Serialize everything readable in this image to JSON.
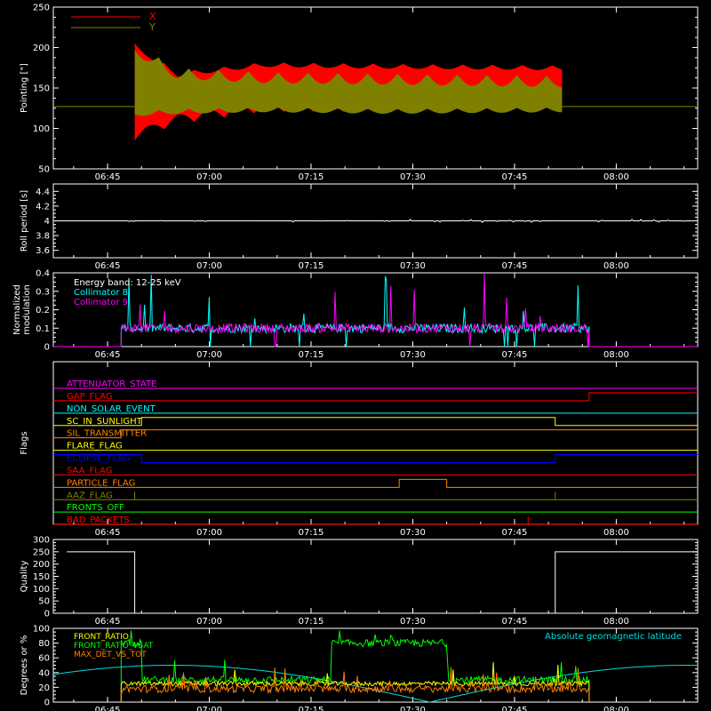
{
  "time_ticks": [
    "06:45",
    "07:00",
    "07:15",
    "07:30",
    "07:45",
    "08:00"
  ],
  "colors": {
    "background": "#000000",
    "axis": "#ffffff",
    "x_series": "#ff0000",
    "y_series": "#808000",
    "collimator8": "#00ffff",
    "collimator9": "#ff00ff",
    "geomag": "#00dddd",
    "front_ratio": "#ffff00",
    "front_ratio_vsat": "#00ff00",
    "max_det_vs_tot": "#ff8000"
  },
  "chart_data": [
    {
      "type": "line",
      "name": "pointing",
      "ylabel": "Pointing [\"]",
      "ylim": [
        50,
        250
      ],
      "yticks": [
        50,
        100,
        150,
        200,
        250
      ],
      "legend": {
        "placement": "top-left",
        "entries": [
          "X",
          "Y"
        ]
      },
      "series": [
        {
          "name": "X",
          "color": "#ff0000",
          "baseline": 127,
          "active_start": "06:49",
          "active_end": "07:52",
          "envelope_upper": [
            [
              0,
              205
            ],
            [
              0.1,
              170
            ],
            [
              0.3,
              182
            ],
            [
              0.6,
              180
            ],
            [
              1,
              178
            ]
          ],
          "envelope_lower": [
            [
              0,
              85
            ],
            [
              0.1,
              105
            ],
            [
              0.3,
              120
            ],
            [
              0.6,
              120
            ],
            [
              1,
              122
            ]
          ]
        },
        {
          "name": "Y",
          "color": "#808000",
          "baseline": 127,
          "active_start": "06:49",
          "active_end": "07:52",
          "envelope_upper": [
            [
              0,
              205
            ],
            [
              0.1,
              175
            ],
            [
              0.3,
              170
            ],
            [
              0.6,
              168
            ],
            [
              1,
              165
            ]
          ],
          "envelope_lower": [
            [
              0,
              115
            ],
            [
              0.1,
              118
            ],
            [
              0.3,
              120
            ],
            [
              0.6,
              118
            ],
            [
              1,
              120
            ]
          ]
        }
      ]
    },
    {
      "type": "line",
      "name": "roll-period",
      "ylabel": "Roll period [s]",
      "ylim": [
        3.5,
        4.5
      ],
      "yticks": [
        3.6,
        3.8,
        4.0,
        4.2,
        4.4
      ],
      "series": [
        {
          "name": "",
          "color": "#ffffff",
          "value": 4.0
        }
      ]
    },
    {
      "type": "line",
      "name": "modulation",
      "ylabel": [
        "Normalized",
        "modulation"
      ],
      "ylim": [
        0,
        0.4
      ],
      "yticks": [
        0.0,
        0.1,
        0.2,
        0.3,
        0.4
      ],
      "legend": {
        "placement": "top-left",
        "entries": [
          "Energy band: 12-25 keV",
          "Collimator 8",
          "Collimator 9"
        ]
      },
      "active_start": "06:47",
      "active_end": "07:56",
      "series": [
        {
          "name": "Collimator 8",
          "color": "#00ffff",
          "typical": 0.1
        },
        {
          "name": "Collimator 9",
          "color": "#ff00ff",
          "typical": 0.1
        }
      ]
    },
    {
      "type": "line",
      "name": "flags",
      "ylabel": "Flags",
      "flags": [
        {
          "label": "ATTENUATOR_STATE",
          "color": "#ff00ff",
          "steps": []
        },
        {
          "label": "GAP_FLAG",
          "color": "#ff0000",
          "steps": [
            [
              "07:56",
              1
            ]
          ]
        },
        {
          "label": "NON_SOLAR_EVENT",
          "color": "#00ffff",
          "steps": []
        },
        {
          "label": "SC_IN_SUNLIGHT",
          "color": "#ffff00",
          "steps": [
            [
              "06:50",
              1
            ],
            [
              "07:51",
              0
            ]
          ]
        },
        {
          "label": "SIL_TRANSMITTER",
          "color": "#ff8000",
          "steps": [
            [
              "06:47",
              1
            ]
          ]
        },
        {
          "label": "FLARE_FLAG",
          "color": "#ffff00",
          "steps": []
        },
        {
          "label": "ECLIPSE_FLAG",
          "color": "#0000ff",
          "steps": [
            [
              "06:50",
              0
            ],
            [
              "07:51",
              1
            ]
          ]
        },
        {
          "label": "SAA_FLAG",
          "color": "#ff0000",
          "steps": []
        },
        {
          "label": "PARTICLE_FLAG",
          "color": "#ff8000",
          "steps": [
            [
              "07:28",
              1
            ],
            [
              "07:35",
              0
            ]
          ]
        },
        {
          "label": "AAZ_FLAG",
          "color": "#808000",
          "spikes": [
            "06:49",
            "07:51"
          ]
        },
        {
          "label": "FRONTS_OFF",
          "color": "#00ff00",
          "steps": []
        },
        {
          "label": "BAD_PACKETS",
          "color": "#ff0000",
          "spikes": [
            "07:47"
          ]
        }
      ]
    },
    {
      "type": "line",
      "name": "quality",
      "ylabel": "Quality",
      "ylim": [
        0,
        300
      ],
      "yticks": [
        0,
        50,
        100,
        150,
        200,
        250,
        300
      ],
      "series": [
        {
          "name": "",
          "color": "#ffffff",
          "steps": [
            [
              "06:39",
              250
            ],
            [
              "06:49",
              0
            ],
            [
              "07:51",
              250
            ]
          ]
        }
      ]
    },
    {
      "type": "line",
      "name": "degrees",
      "ylabel": "Degrees or %",
      "ylim": [
        0,
        100
      ],
      "yticks": [
        0,
        20,
        40,
        60,
        80,
        100
      ],
      "legend": {
        "placement": "top-left",
        "entries": [
          "FRONT_RATIO",
          "FRONT_RATIO_VSAT",
          "MAX_DET_VS_TOT"
        ]
      },
      "legend_right": "Absolute geomagnetic latitude",
      "series": [
        {
          "name": "FRONT_RATIO",
          "color": "#ffff00",
          "typical": 25
        },
        {
          "name": "FRONT_RATIO_VSAT",
          "color": "#00ff00",
          "levels": [
            [
              "06:47",
              80
            ],
            [
              "06:50",
              30
            ],
            [
              "07:18",
              80
            ],
            [
              "07:35",
              30
            ]
          ]
        },
        {
          "name": "MAX_DET_VS_TOT",
          "color": "#ff8000",
          "typical": 18
        },
        {
          "name": "Absolute geomagnetic latitude",
          "color": "#00dddd",
          "amplitude": 50
        }
      ]
    }
  ]
}
